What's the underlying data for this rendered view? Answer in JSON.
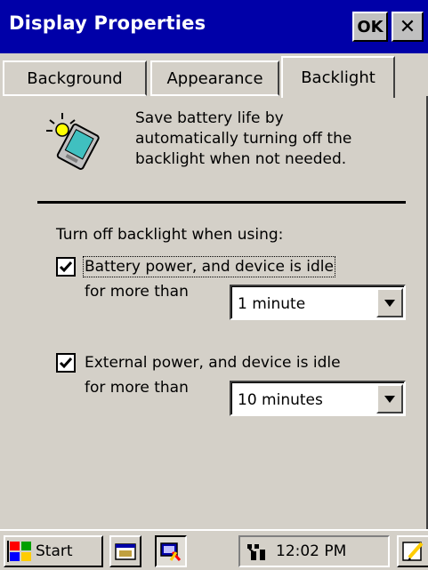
{
  "window": {
    "title": "Display Properties",
    "ok_label": "OK",
    "close_label": "✕"
  },
  "tabs": [
    {
      "label": "Background",
      "active": false
    },
    {
      "label": "Appearance",
      "active": false
    },
    {
      "label": "Backlight",
      "active": true
    }
  ],
  "backlight": {
    "description": "Save battery life by automatically turning off the backlight when not needed.",
    "description_lines": [
      "Save battery life by",
      "automatically turning off the",
      "backlight when not needed."
    ],
    "section_label": "Turn off backlight when using:",
    "battery": {
      "checked": true,
      "label": "Battery power, and device is idle",
      "for_label": "for more than",
      "timeout": "1 minute"
    },
    "external": {
      "checked": true,
      "label": "External power, and device is idle",
      "for_label": "for more than",
      "timeout": "10 minutes"
    }
  },
  "taskbar": {
    "start_label": "Start",
    "clock": "12:02 PM"
  },
  "colors": {
    "titlebar": "#0000a8",
    "face": "#d4d0c8"
  }
}
